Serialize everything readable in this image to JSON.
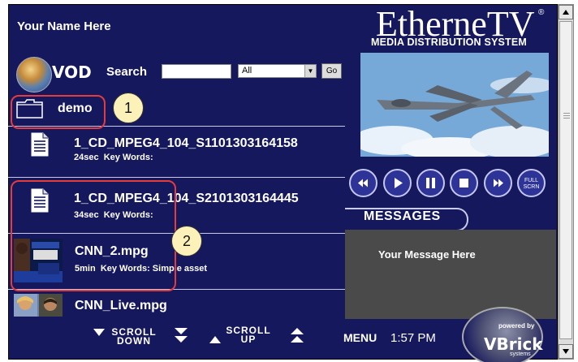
{
  "header": {
    "user_name": "Your Name Here",
    "logo_title": "EtherneTV",
    "logo_registered": "®",
    "logo_subtitle": "MEDIA DISTRIBUTION SYSTEM"
  },
  "toolbar": {
    "vod_label": "VOD",
    "search_label": "Search",
    "search_value": "",
    "filter_selected": "All",
    "go_label": "Go"
  },
  "list": {
    "folder": {
      "name": "demo",
      "icon": "folder-icon"
    },
    "items": [
      {
        "title": "1_CD_MPEG4_104_S1101303164158",
        "duration": "24sec",
        "keywords_label": "Key Words:",
        "keywords": "",
        "icon": "document-icon"
      },
      {
        "title": "1_CD_MPEG4_104_S2101303164445",
        "duration": "34sec",
        "keywords_label": "Key Words:",
        "keywords": "",
        "icon": "document-icon"
      },
      {
        "title": "CNN_2.mpg",
        "duration": "5min",
        "keywords_label": "Key Words:",
        "keywords": "Simple asset",
        "icon": "video-thumbnail"
      },
      {
        "title": "CNN_Live.mpg",
        "duration": "",
        "keywords_label": "",
        "keywords": "",
        "icon": "video-thumbnail"
      }
    ]
  },
  "annotations": {
    "callout_1": "1",
    "callout_2": "2"
  },
  "player": {
    "controls": [
      "rewind-icon",
      "play-icon",
      "pause-icon",
      "stop-icon",
      "fast-forward-icon",
      "full-screen-icon"
    ],
    "fullscreen_line1": "FULL",
    "fullscreen_line2": "SCRN"
  },
  "messages": {
    "tab_label": "MESSAGES",
    "text": "Your Message Here"
  },
  "footer": {
    "scroll_down_line1": "SCROLL",
    "scroll_down_line2": "DOWN",
    "scroll_up_line1": "SCROLL",
    "scroll_up_line2": "UP",
    "menu_label": "MENU",
    "time": "1:57 PM"
  },
  "branding": {
    "powered_by": "powered by",
    "name": "VBrick",
    "tagline": "systems"
  },
  "colors": {
    "background": "#16185e",
    "highlight": "#e23c3c",
    "callout_fill": "#fcf2b9",
    "message_panel": "#4a4a4a"
  }
}
